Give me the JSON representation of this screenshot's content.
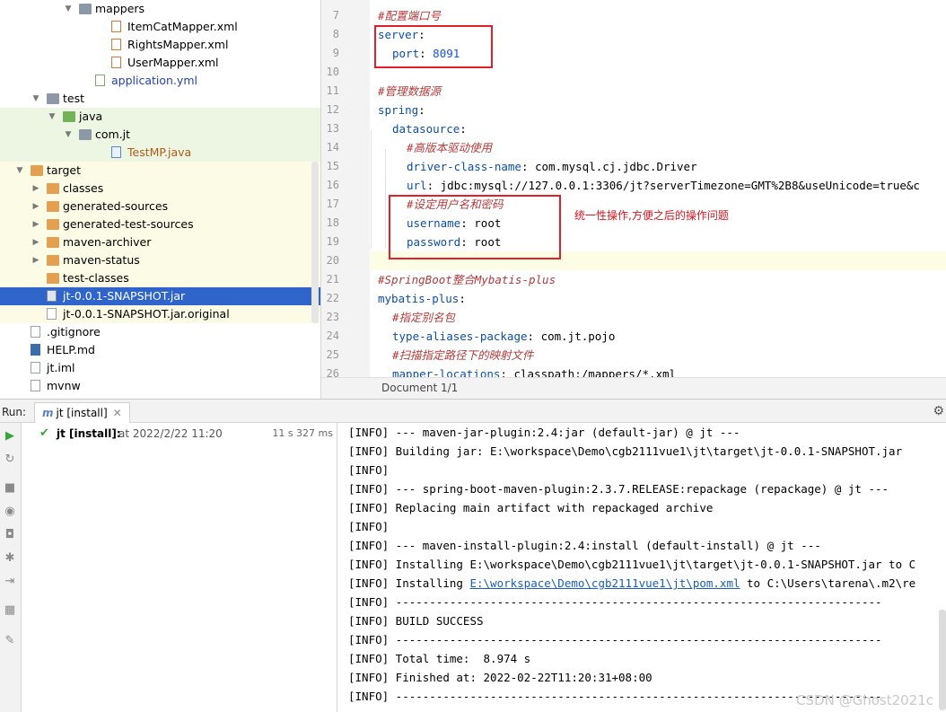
{
  "tree": {
    "items": [
      {
        "label": "mappers",
        "bg": "",
        "arrow": "▼",
        "indent": 88,
        "icon": "folder-icon",
        "iconClass": "folder",
        "labelClass": ""
      },
      {
        "label": "ItemCatMapper.xml",
        "bg": "",
        "arrow": "",
        "indent": 124,
        "icon": "xml-file-icon",
        "iconClass": "fileic xml",
        "labelClass": ""
      },
      {
        "label": "RightsMapper.xml",
        "bg": "",
        "arrow": "",
        "indent": 124,
        "icon": "xml-file-icon",
        "iconClass": "fileic xml",
        "labelClass": ""
      },
      {
        "label": "UserMapper.xml",
        "bg": "",
        "arrow": "",
        "indent": 124,
        "icon": "xml-file-icon",
        "iconClass": "fileic xml",
        "labelClass": ""
      },
      {
        "label": "application.yml",
        "bg": "",
        "arrow": "",
        "indent": 106,
        "icon": "yml-file-icon",
        "iconClass": "fileic yml",
        "labelClass": "blue"
      },
      {
        "label": "test",
        "bg": "",
        "arrow": "▼",
        "indent": 52,
        "icon": "folder-icon",
        "iconClass": "folder",
        "labelClass": ""
      },
      {
        "label": "java",
        "bg": "green",
        "arrow": "▼",
        "indent": 70,
        "icon": "source-folder-icon",
        "iconClass": "folder green",
        "labelClass": ""
      },
      {
        "label": "com.jt",
        "bg": "green",
        "arrow": "▼",
        "indent": 88,
        "icon": "package-icon",
        "iconClass": "folder",
        "labelClass": ""
      },
      {
        "label": "TestMP.java",
        "bg": "green",
        "arrow": "",
        "indent": 124,
        "icon": "java-file-icon",
        "iconClass": "fileic java",
        "labelClass": "orange-t"
      },
      {
        "label": "target",
        "bg": "yellow",
        "arrow": "▼",
        "indent": 34,
        "icon": "folder-icon",
        "iconClass": "folder orange",
        "labelClass": ""
      },
      {
        "label": "classes",
        "bg": "yellow",
        "arrow": "▶",
        "indent": 52,
        "icon": "folder-icon",
        "iconClass": "folder orange",
        "labelClass": ""
      },
      {
        "label": "generated-sources",
        "bg": "yellow",
        "arrow": "▶",
        "indent": 52,
        "icon": "folder-icon",
        "iconClass": "folder orange",
        "labelClass": ""
      },
      {
        "label": "generated-test-sources",
        "bg": "yellow",
        "arrow": "▶",
        "indent": 52,
        "icon": "folder-icon",
        "iconClass": "folder orange",
        "labelClass": ""
      },
      {
        "label": "maven-archiver",
        "bg": "yellow",
        "arrow": "▶",
        "indent": 52,
        "icon": "folder-icon",
        "iconClass": "folder orange",
        "labelClass": ""
      },
      {
        "label": "maven-status",
        "bg": "yellow",
        "arrow": "▶",
        "indent": 52,
        "icon": "folder-icon",
        "iconClass": "folder orange",
        "labelClass": ""
      },
      {
        "label": "test-classes",
        "bg": "yellow",
        "arrow": "",
        "indent": 52,
        "icon": "folder-icon",
        "iconClass": "folder orange",
        "labelClass": ""
      },
      {
        "label": "jt-0.0.1-SNAPSHOT.jar",
        "bg": "sel",
        "arrow": "",
        "indent": 52,
        "icon": "jar-file-icon",
        "iconClass": "fileic jar",
        "labelClass": ""
      },
      {
        "label": "jt-0.0.1-SNAPSHOT.jar.original",
        "bg": "yellow",
        "arrow": "",
        "indent": 52,
        "icon": "file-icon",
        "iconClass": "fileic",
        "labelClass": ""
      },
      {
        "label": ".gitignore",
        "bg": "",
        "arrow": "",
        "indent": 34,
        "icon": "file-icon",
        "iconClass": "fileic",
        "labelClass": ""
      },
      {
        "label": "HELP.md",
        "bg": "",
        "arrow": "",
        "indent": 34,
        "icon": "markdown-file-icon",
        "iconClass": "fileic md",
        "labelClass": ""
      },
      {
        "label": "jt.iml",
        "bg": "",
        "arrow": "",
        "indent": 34,
        "icon": "iml-file-icon",
        "iconClass": "fileic",
        "labelClass": ""
      },
      {
        "label": "mvnw",
        "bg": "",
        "arrow": "",
        "indent": 34,
        "icon": "file-icon",
        "iconClass": "fileic",
        "labelClass": ""
      }
    ]
  },
  "editor": {
    "lines": [
      {
        "n": "7",
        "indent": 0,
        "parts": [
          {
            "t": "#配置端口号",
            "c": "cm red"
          }
        ]
      },
      {
        "n": "8",
        "indent": 0,
        "parts": [
          {
            "t": "server",
            "c": "key"
          },
          {
            "t": ":",
            "c": "val"
          }
        ]
      },
      {
        "n": "9",
        "indent": 2,
        "parts": [
          {
            "t": "port",
            "c": "key"
          },
          {
            "t": ": ",
            "c": "val"
          },
          {
            "t": "8091",
            "c": "num"
          }
        ]
      },
      {
        "n": "10",
        "indent": 0,
        "parts": []
      },
      {
        "n": "11",
        "indent": 0,
        "parts": [
          {
            "t": "#管理数据源",
            "c": "cm red"
          }
        ]
      },
      {
        "n": "12",
        "indent": 0,
        "parts": [
          {
            "t": "spring",
            "c": "key"
          },
          {
            "t": ":",
            "c": "val"
          }
        ]
      },
      {
        "n": "13",
        "indent": 2,
        "parts": [
          {
            "t": "datasource",
            "c": "key"
          },
          {
            "t": ":",
            "c": "val"
          }
        ]
      },
      {
        "n": "14",
        "indent": 4,
        "parts": [
          {
            "t": "#高版本驱动使用",
            "c": "cm red"
          }
        ]
      },
      {
        "n": "15",
        "indent": 4,
        "parts": [
          {
            "t": "driver-class-name",
            "c": "key"
          },
          {
            "t": ": com.mysql.cj.jdbc.Driver",
            "c": "val"
          }
        ]
      },
      {
        "n": "16",
        "indent": 4,
        "parts": [
          {
            "t": "url",
            "c": "key"
          },
          {
            "t": ": jdbc:mysql://127.0.0.1:3306/jt?serverTimezone=GMT%2B8&useUnicode=true&c",
            "c": "val"
          }
        ]
      },
      {
        "n": "17",
        "indent": 4,
        "parts": [
          {
            "t": "#设定用户名和密码",
            "c": "cm red"
          }
        ]
      },
      {
        "n": "18",
        "indent": 4,
        "parts": [
          {
            "t": "username",
            "c": "key"
          },
          {
            "t": ": root",
            "c": "val"
          }
        ]
      },
      {
        "n": "19",
        "indent": 4,
        "parts": [
          {
            "t": "password",
            "c": "key"
          },
          {
            "t": ": root",
            "c": "val"
          }
        ]
      },
      {
        "n": "20",
        "indent": 0,
        "parts": []
      },
      {
        "n": "21",
        "indent": 0,
        "parts": [
          {
            "t": "#SpringBoot整合Mybatis-plus",
            "c": "cm red"
          }
        ]
      },
      {
        "n": "22",
        "indent": 0,
        "parts": [
          {
            "t": "mybatis-plus",
            "c": "key"
          },
          {
            "t": ":",
            "c": "val"
          }
        ]
      },
      {
        "n": "23",
        "indent": 2,
        "parts": [
          {
            "t": "#指定别名包",
            "c": "cm red"
          }
        ]
      },
      {
        "n": "24",
        "indent": 2,
        "parts": [
          {
            "t": "type-aliases-package",
            "c": "key"
          },
          {
            "t": ": com.jt.pojo",
            "c": "val"
          }
        ]
      },
      {
        "n": "25",
        "indent": 2,
        "parts": [
          {
            "t": "#扫描指定路径下的映射文件",
            "c": "cm red"
          }
        ]
      },
      {
        "n": "26",
        "indent": 2,
        "parts": [
          {
            "t": "mapper-locations",
            "c": "key"
          },
          {
            "t": ": classpath:/mappers/*.xml",
            "c": "val"
          }
        ]
      }
    ],
    "annotation": "统一性操作,方便之后的操作问题",
    "breadcrumb": "Document 1/1"
  },
  "run": {
    "label": "Run:",
    "tab_label": "jt [install]",
    "tree_name": "jt [install]:",
    "tree_at": "at 2022/2/22 11:20",
    "tree_duration": "11 s 327 ms",
    "console": [
      "[INFO] --- maven-jar-plugin:2.4:jar (default-jar) @ jt ---",
      "[INFO] Building jar: E:\\workspace\\Demo\\cgb2111vue1\\jt\\target\\jt-0.0.1-SNAPSHOT.jar",
      "[INFO]",
      "[INFO] --- spring-boot-maven-plugin:2.3.7.RELEASE:repackage (repackage) @ jt ---",
      "[INFO] Replacing main artifact with repackaged archive",
      "[INFO]",
      "[INFO] --- maven-install-plugin:2.4:install (default-install) @ jt ---",
      "[INFO] Installing E:\\workspace\\Demo\\cgb2111vue1\\jt\\target\\jt-0.0.1-SNAPSHOT.jar to C",
      "",
      "[INFO] ------------------------------------------------------------------------",
      "[INFO] BUILD SUCCESS",
      "[INFO] ------------------------------------------------------------------------",
      "[INFO] Total time:  8.974 s",
      "[INFO] Finished at: 2022-02-22T11:20:31+08:00",
      "[INFO] ------------------------------------------------------------------------"
    ],
    "console_link_line": {
      "prefix": "[INFO] Installing ",
      "link": "E:\\workspace\\Demo\\cgb2111vue1\\jt\\pom.xml",
      "suffix": " to C:\\Users\\tarena\\.m2\\re"
    },
    "watermark": "CSDN @Ghost2021c"
  }
}
